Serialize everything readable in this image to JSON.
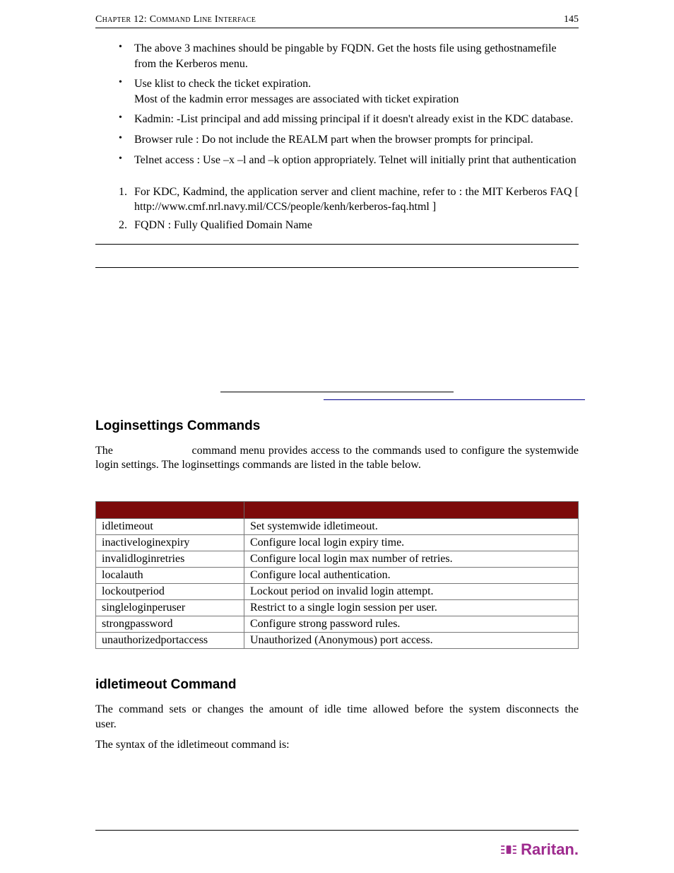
{
  "header": {
    "left": "Chapter 12: Command Line Interface",
    "right": "145"
  },
  "bullets": [
    "The above 3 machines should be pingable by FQDN. Get the hosts file using gethostnamefile from the Kerberos menu.",
    "Use klist to check the ticket expiration.\nMost of the kadmin error messages are associated with ticket expiration",
    "Kadmin: -List principal and add missing principal if it doesn't already exist in the KDC database.",
    "Browser rule : Do not include the REALM part when the browser prompts for principal.",
    "Telnet access : Use –x –l and –k option appropriately. Telnet will initially print that authentication"
  ],
  "numbered": [
    "For KDC, Kadmind, the application server and client machine,  refer to : the MIT Kerberos FAQ [ http://www.cmf.nrl.navy.mil/CCS/people/kenh/kerberos-faq.html ]",
    "FQDN : Fully Qualified Domain Name"
  ],
  "loginsettings": {
    "heading": "Loginsettings Commands",
    "intro_pre": "The ",
    "intro_post": " command menu provides access to the commands used to configure the systemwide login settings. The loginsettings commands are listed in the table below.",
    "rows": [
      {
        "cmd": "idletimeout",
        "desc": "Set systemwide idletimeout."
      },
      {
        "cmd": "inactiveloginexpiry",
        "desc": "Configure local login expiry time."
      },
      {
        "cmd": "invalidloginretries",
        "desc": "Configure local login max number of retries."
      },
      {
        "cmd": "localauth",
        "desc": "Configure local authentication."
      },
      {
        "cmd": "lockoutperiod",
        "desc": "Lockout period on invalid login attempt."
      },
      {
        "cmd": "singleloginperuser",
        "desc": "Restrict to a single login session per user."
      },
      {
        "cmd": "strongpassword",
        "desc": "Configure strong password rules."
      },
      {
        "cmd": "unauthorizedportaccess",
        "desc": "Unauthorized (Anonymous) port access."
      }
    ]
  },
  "idletimeout": {
    "heading": "idletimeout Command",
    "para": "The                 command sets or changes the amount of idle time allowed before the system disconnects the user.",
    "syntax": "The syntax of the idletimeout command is:"
  },
  "footer": {
    "brand": "Raritan."
  }
}
